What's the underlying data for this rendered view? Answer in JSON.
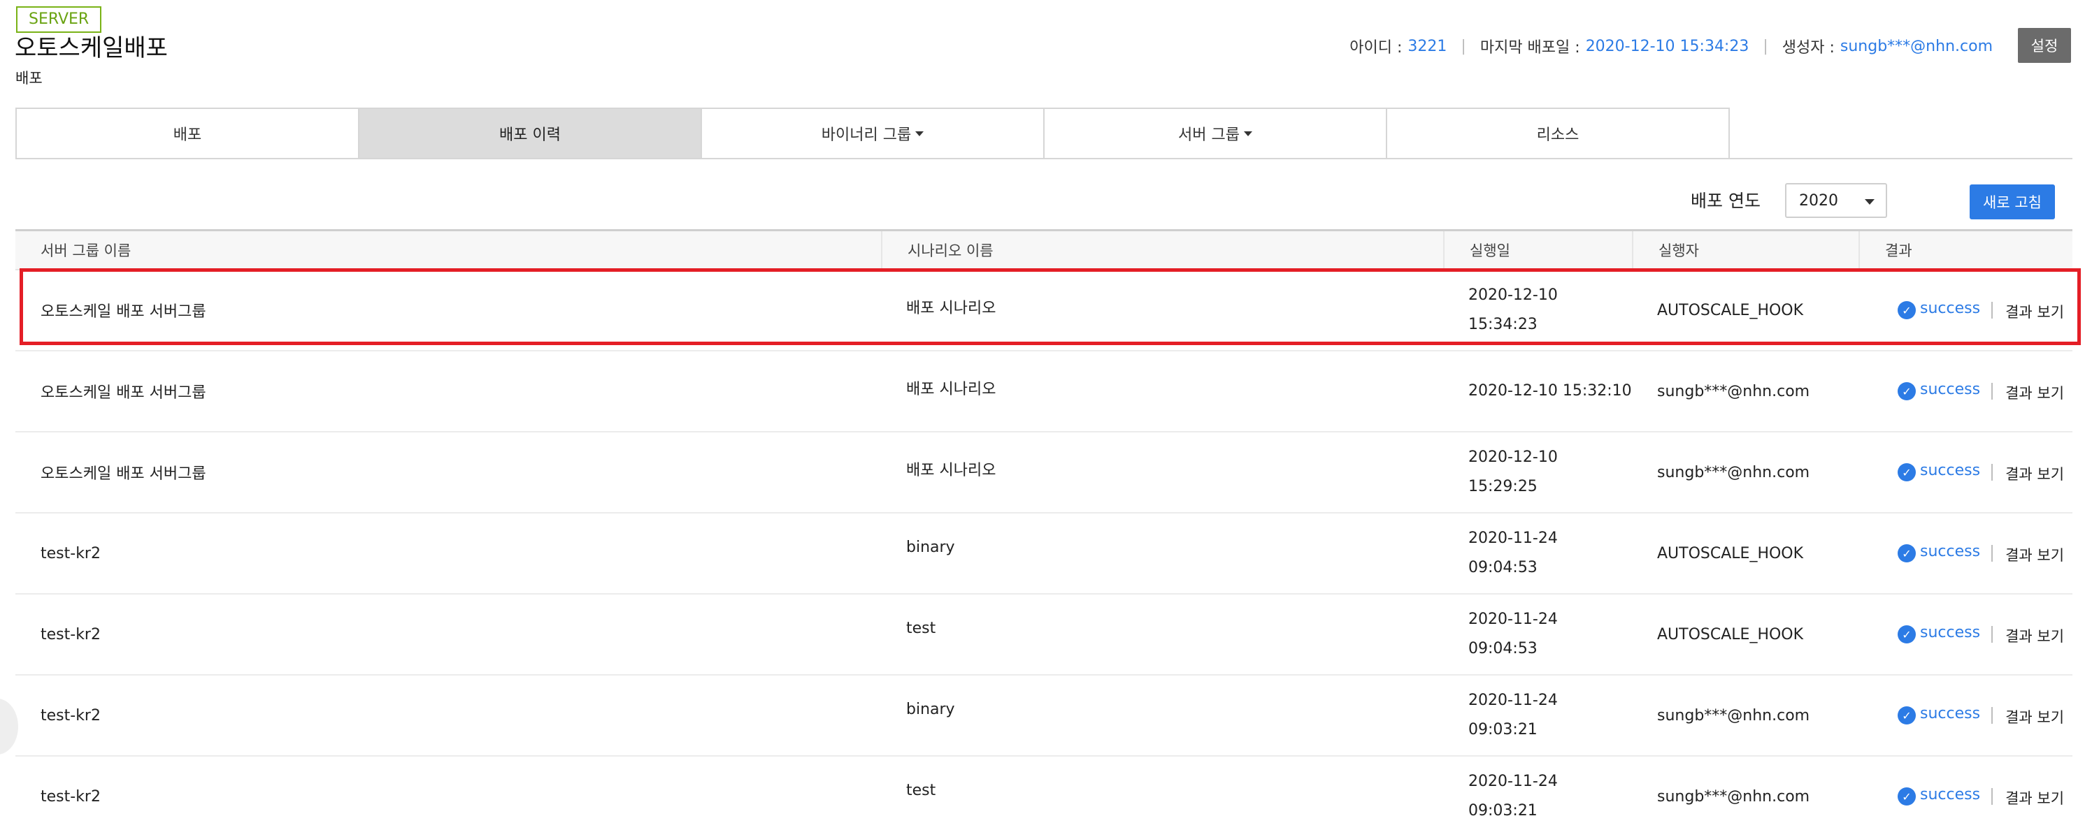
{
  "header": {
    "badge": "SERVER",
    "title": "오토스케일배포",
    "subtitle": "배포",
    "meta": {
      "id_label": "아이디 :",
      "id_value": "3221",
      "last_deploy_label": "마지막 배포일 :",
      "last_deploy_value": "2020-12-10 15:34:23",
      "creator_label": "생성자 :",
      "creator_value": "sungb***@nhn.com"
    },
    "settings_label": "설정"
  },
  "tabs": [
    {
      "label": "배포",
      "dropdown": false,
      "active": false
    },
    {
      "label": "배포 이력",
      "dropdown": false,
      "active": true
    },
    {
      "label": "바이너리 그룹",
      "dropdown": true,
      "active": false
    },
    {
      "label": "서버 그룹",
      "dropdown": true,
      "active": false
    },
    {
      "label": "리소스",
      "dropdown": false,
      "active": false
    }
  ],
  "controls": {
    "year_label": "배포 연도",
    "year_value": "2020",
    "refresh_label": "새로 고침"
  },
  "table": {
    "headers": [
      "서버 그룹 이름",
      "시나리오 이름",
      "실행일",
      "실행자",
      "결과"
    ],
    "rows": [
      {
        "group": "오토스케일 배포 서버그룹",
        "scenario": "배포 시나리오",
        "date_line1": "2020-12-10",
        "date_line2": "15:34:23",
        "executor": "AUTOSCALE_HOOK",
        "status": "success",
        "view": "결과 보기"
      },
      {
        "group": "오토스케일 배포 서버그룹",
        "scenario": "배포 시나리오",
        "date_line1": "2020-12-10 15:32:10",
        "date_line2": "",
        "executor": "sungb***@nhn.com",
        "status": "success",
        "view": "결과 보기"
      },
      {
        "group": "오토스케일 배포 서버그룹",
        "scenario": "배포 시나리오",
        "date_line1": "2020-12-10",
        "date_line2": "15:29:25",
        "executor": "sungb***@nhn.com",
        "status": "success",
        "view": "결과 보기"
      },
      {
        "group": "test-kr2",
        "scenario": "binary",
        "date_line1": "2020-11-24",
        "date_line2": "09:04:53",
        "executor": "AUTOSCALE_HOOK",
        "status": "success",
        "view": "결과 보기"
      },
      {
        "group": "test-kr2",
        "scenario": "test",
        "date_line1": "2020-11-24",
        "date_line2": "09:04:53",
        "executor": "AUTOSCALE_HOOK",
        "status": "success",
        "view": "결과 보기"
      },
      {
        "group": "test-kr2",
        "scenario": "binary",
        "date_line1": "2020-11-24",
        "date_line2": "09:03:21",
        "executor": "sungb***@nhn.com",
        "status": "success",
        "view": "결과 보기"
      },
      {
        "group": "test-kr2",
        "scenario": "test",
        "date_line1": "2020-11-24",
        "date_line2": "09:03:21",
        "executor": "sungb***@nhn.com",
        "status": "success",
        "view": "결과 보기"
      }
    ]
  },
  "colors": {
    "accent": "#2c7be5",
    "badge": "#6aa312",
    "highlight": "#e41e26",
    "active_tab": "#dcdcdc"
  },
  "icons": {
    "status": "check-circle-icon",
    "dropdown": "caret-down-icon"
  }
}
